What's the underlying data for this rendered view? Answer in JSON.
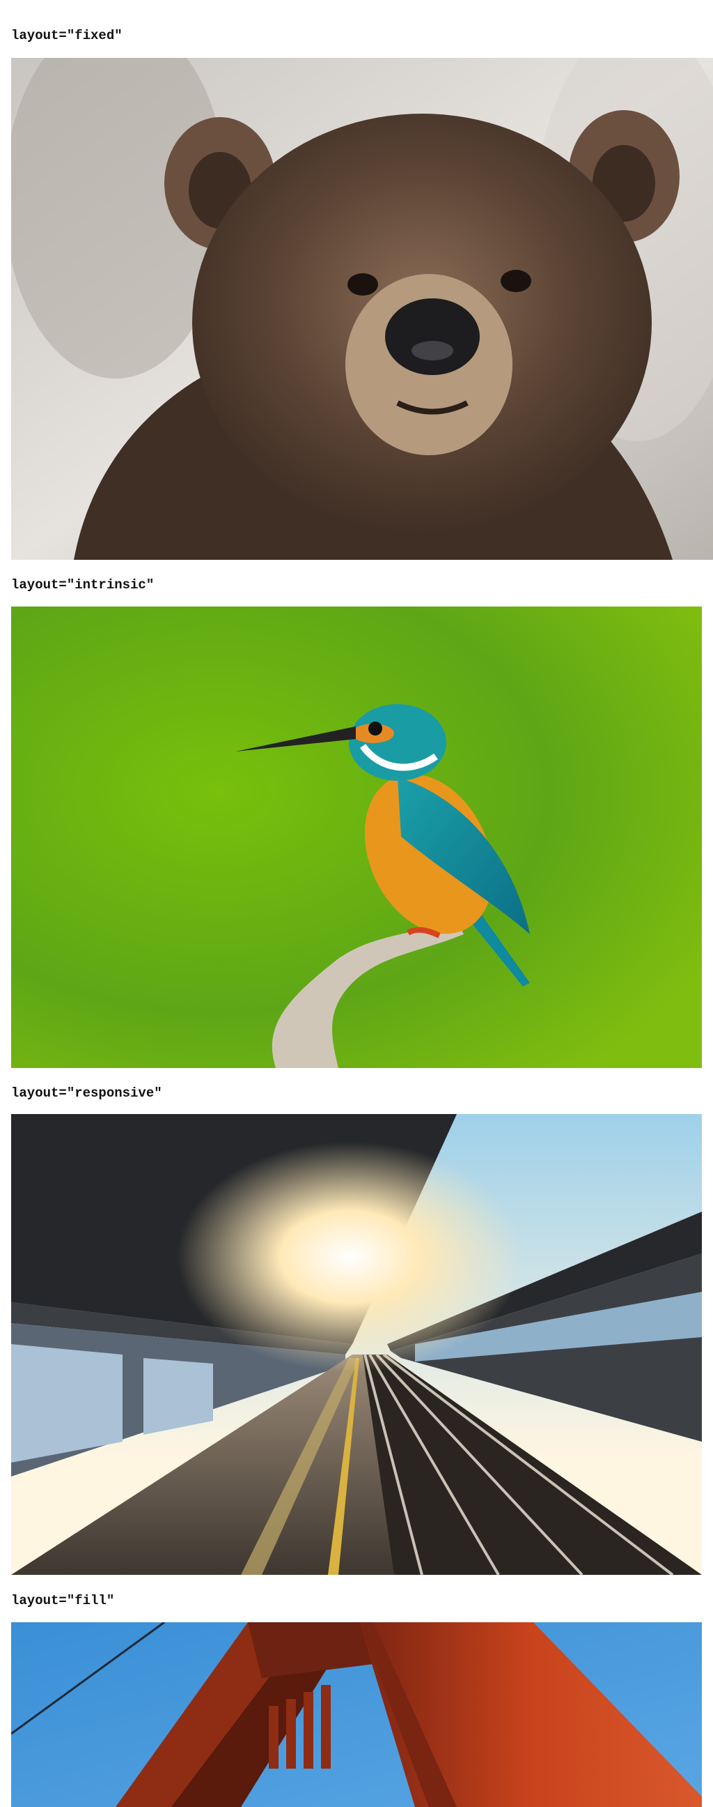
{
  "sections": [
    {
      "label": "layout=\"fixed\"",
      "image": "bear-photo"
    },
    {
      "label": "layout=\"intrinsic\"",
      "image": "kingfisher-photo"
    },
    {
      "label": "layout=\"responsive\"",
      "image": "train-platform-photo"
    },
    {
      "label": "layout=\"fill\"",
      "image": "red-bridge-tower-photo"
    }
  ],
  "colors": {
    "background": "#ffffff",
    "label_text": "#111111",
    "kingfisher_background": "#6fb512",
    "bridge_red": "#c9431c",
    "sky_blue": "#3a8fd6"
  }
}
